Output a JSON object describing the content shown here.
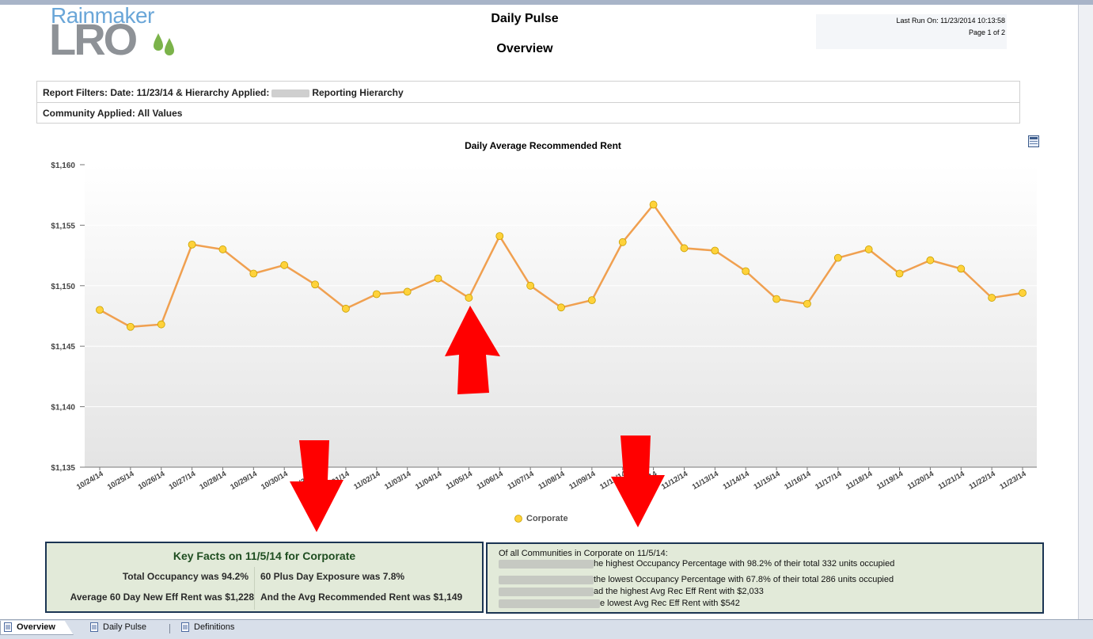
{
  "logo": {
    "line1": "Rainmaker",
    "line2": "LRO"
  },
  "header": {
    "title": "Daily Pulse",
    "subtitle": "Overview",
    "last_run": "Last Run On: 11/23/2014 10:13:58",
    "page": "Page 1 of 2"
  },
  "filters": {
    "row1_prefix": "Report Filters: Date: 11/23/14 & Hierarchy Applied:",
    "row1_suffix": "Reporting Hierarchy",
    "row2": "Community Applied: All Values"
  },
  "chart_data": {
    "type": "line",
    "title": "Daily Average Recommended Rent",
    "categories": [
      "10/24/14",
      "10/25/14",
      "10/26/14",
      "10/27/14",
      "10/28/14",
      "10/29/14",
      "10/30/14",
      "10/31/14",
      "11/01/14",
      "11/02/14",
      "11/03/14",
      "11/04/14",
      "11/05/14",
      "11/06/14",
      "11/07/14",
      "11/08/14",
      "11/09/14",
      "11/10/14",
      "11/11/14",
      "11/12/14",
      "11/13/14",
      "11/14/14",
      "11/15/14",
      "11/16/14",
      "11/17/14",
      "11/18/14",
      "11/19/14",
      "11/20/14",
      "11/21/14",
      "11/22/14",
      "11/23/14"
    ],
    "series": [
      {
        "name": "Corporate",
        "color": "#f0a050",
        "values": [
          1148.0,
          1146.6,
          1146.8,
          1153.4,
          1153.0,
          1151.0,
          1151.7,
          1150.1,
          1148.1,
          1149.3,
          1149.5,
          1150.6,
          1149.0,
          1154.1,
          1150.0,
          1148.2,
          1148.8,
          1153.6,
          1156.7,
          1153.1,
          1152.9,
          1151.2,
          1148.9,
          1148.5,
          1152.3,
          1153.0,
          1151.0,
          1152.1,
          1151.4,
          1149.0,
          1149.4
        ]
      }
    ],
    "yticks": [
      "$1,160",
      "$1,155",
      "$1,150",
      "$1,145",
      "$1,140",
      "$1,135"
    ],
    "ylim": [
      1135,
      1160
    ],
    "legend": "bottom-center",
    "grid": true
  },
  "key_facts": {
    "title": "Key Facts on 11/5/14 for Corporate",
    "occupancy": "Total Occupancy was 94.2%",
    "exposure": "60 Plus Day Exposure was 7.8%",
    "new_eff_rent": "Average 60 Day New Eff Rent was $1,228",
    "avg_rec_rent": "And the Avg Recommended Rent was $1,149"
  },
  "communities": {
    "header": "Of all Communities in Corporate on 11/5/14:",
    "line1": "he highest Occupancy Percentage with 98.2% of their  total 332 units occupied",
    "line2": "the lowest Occupancy Percentage with 67.8% of their total 286  units occupied",
    "line3": "ad the highest Avg Rec Eff Rent with $2,033",
    "line4": "e lowest Avg Rec Eff Rent with $542"
  },
  "tabs": [
    {
      "label": "Overview",
      "active": true
    },
    {
      "label": "Daily Pulse",
      "active": false
    },
    {
      "label": "Definitions",
      "active": false
    }
  ],
  "colors": {
    "arrow": "#ff0000",
    "panel_bg": "#e2ead9",
    "panel_border": "#1b3553",
    "line": "#f0a050",
    "marker": "#ffd23a"
  }
}
